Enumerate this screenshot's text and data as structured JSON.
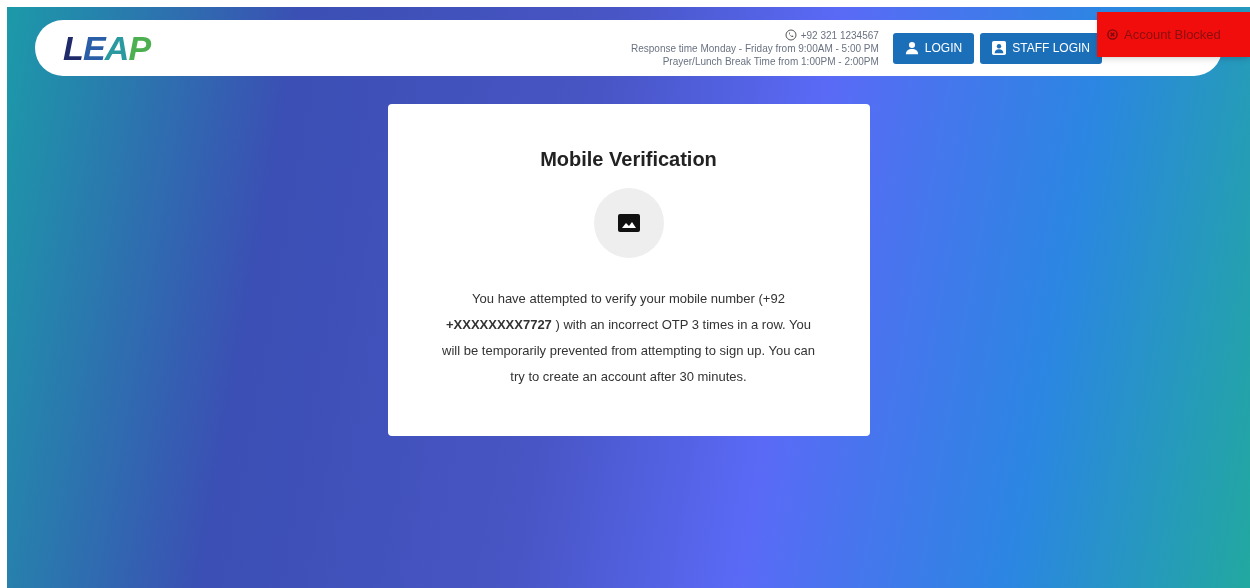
{
  "header": {
    "logo": "LEAP",
    "phone": "+92 321 1234567",
    "hours": [
      "Response time Monday - Friday from 9:00AM - 5:00 PM",
      "Prayer/Lunch Break Time from 1:00PM - 2:00PM"
    ],
    "buttons": [
      {
        "kind": "user",
        "label": "LOGIN"
      },
      {
        "kind": "badge",
        "label": "STAFF LOGIN"
      }
    ]
  },
  "toast": {
    "kind": "error",
    "message": "Account Blocked"
  },
  "card": {
    "title": "Mobile Verification",
    "message": "You have attempted to verify your mobile number (+92 **+XXXXXXXX7727** ) with an incorrect OTP 3 times in a row. You will be temporarily prevented from attempting to sign up. You can try to create an account after 30 minutes."
  }
}
